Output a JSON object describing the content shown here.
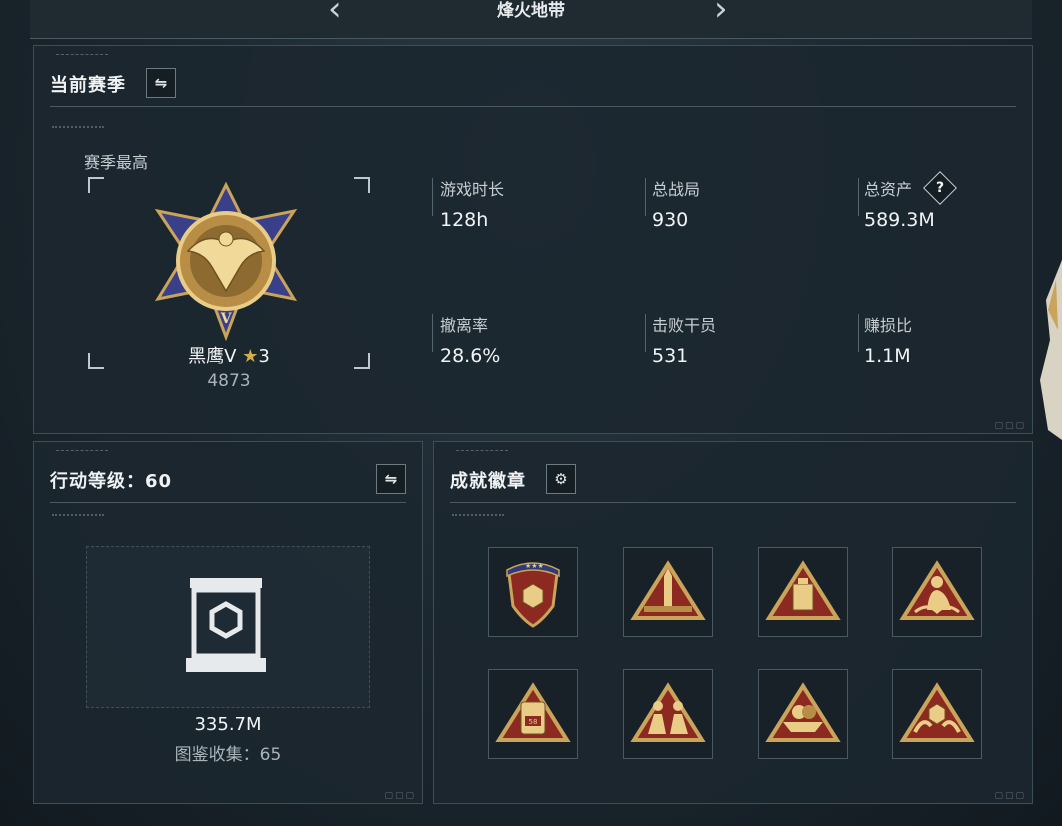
{
  "header": {
    "title": "烽火地带",
    "prev_icon": "chevron-left-icon",
    "next_icon": "chevron-right-icon"
  },
  "season": {
    "title": "当前赛季",
    "switch_icon": "swap-icon",
    "best_label": "赛季最高",
    "rank_name": "黑鹰V",
    "rank_stars": "3",
    "rank_score": "4873",
    "stats": [
      {
        "label": "游戏时长",
        "value": "128h"
      },
      {
        "label": "总战局",
        "value": "930"
      },
      {
        "label": "总资产",
        "value": "589.3M"
      },
      {
        "label": "撤离率",
        "value": "28.6%"
      },
      {
        "label": "击败干员",
        "value": "531"
      },
      {
        "label": "赚损比",
        "value": "1.1M"
      }
    ],
    "help_icon": "?"
  },
  "level": {
    "title": "行动等级：60",
    "switch_icon": "swap-icon",
    "value": "335.7M",
    "collection": "图鉴收集：65"
  },
  "achievements": {
    "title": "成就徽章",
    "settings_icon": "gear-icon",
    "badges": [
      {
        "name": "shield-badge"
      },
      {
        "name": "rocket-badge"
      },
      {
        "name": "device-badge"
      },
      {
        "name": "soldier-badge"
      },
      {
        "name": "phone-58-badge"
      },
      {
        "name": "squad-badge"
      },
      {
        "name": "boat-badge"
      },
      {
        "name": "hands-gem-badge"
      }
    ],
    "badge_58": "58"
  },
  "colors": {
    "accent_gold": "#c9a45a",
    "badge_red": "#8c2a22",
    "panel_bg": "#1b272f"
  }
}
